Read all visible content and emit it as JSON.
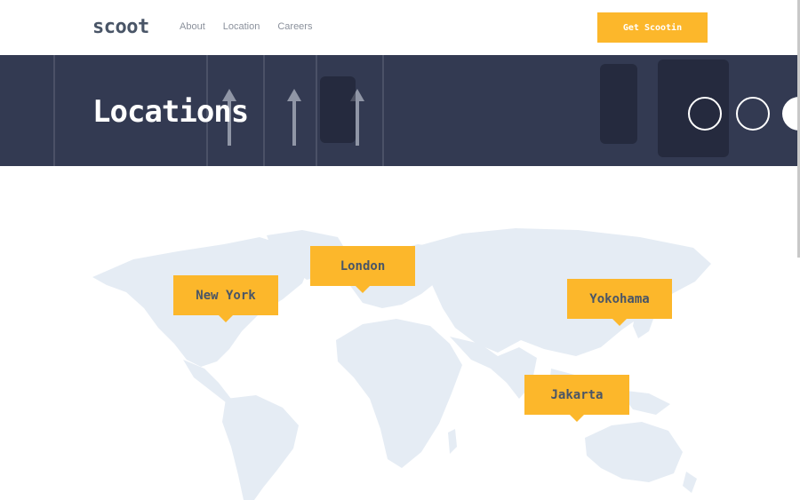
{
  "header": {
    "logo": "scoot",
    "nav": [
      "About",
      "Location",
      "Careers"
    ],
    "cta_label": "Get Scootin"
  },
  "hero": {
    "title": "Locations"
  },
  "map": {
    "pins": [
      "New York",
      "London",
      "Yokohama",
      "Jakarta"
    ]
  },
  "colors": {
    "accent": "#fcb72b",
    "heading": "#495567",
    "hero_bg": "#333a52",
    "map_land": "#e5ecf4"
  }
}
